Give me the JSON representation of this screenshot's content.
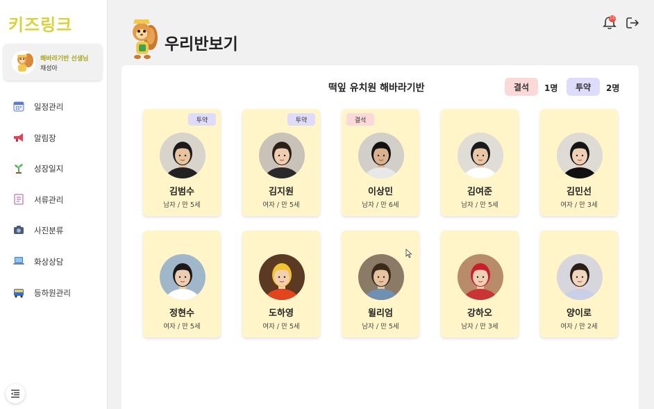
{
  "app": {
    "logo": "키즈링크"
  },
  "profile": {
    "role": "해바라기반 선생님",
    "name": "채성아"
  },
  "menu": [
    {
      "label": "일정관리",
      "icon": "calendar-icon"
    },
    {
      "label": "알림장",
      "icon": "megaphone-icon"
    },
    {
      "label": "성장일지",
      "icon": "sprout-icon"
    },
    {
      "label": "서류관리",
      "icon": "document-icon"
    },
    {
      "label": "사진분류",
      "icon": "camera-icon"
    },
    {
      "label": "화상상담",
      "icon": "laptop-icon"
    },
    {
      "label": "등하원관리",
      "icon": "bus-icon"
    }
  ],
  "header": {
    "title": "우리반보기",
    "notification_count": "15"
  },
  "class_info": {
    "title": "떡잎 유치원 해바라기반",
    "absent_label": "결석",
    "absent_count": "1명",
    "medication_label": "투약",
    "medication_count": "2명"
  },
  "children": [
    {
      "name": "김범수",
      "info": "남자 / 만 5세",
      "tag": "투약"
    },
    {
      "name": "김지원",
      "info": "여자 / 만 5세",
      "tag": "투약"
    },
    {
      "name": "이상민",
      "info": "남자 / 만 6세",
      "tag": "결석"
    },
    {
      "name": "김여준",
      "info": "남자 / 만 5세",
      "tag": ""
    },
    {
      "name": "김민선",
      "info": "여자 / 만 3세",
      "tag": ""
    },
    {
      "name": "정현수",
      "info": "여자 / 만 5세",
      "tag": ""
    },
    {
      "name": "도하영",
      "info": "여자 / 만 5세",
      "tag": ""
    },
    {
      "name": "윌리엄",
      "info": "남자 / 만 5세",
      "tag": ""
    },
    {
      "name": "강하오",
      "info": "남자 / 만 3세",
      "tag": ""
    },
    {
      "name": "양이로",
      "info": "여자 / 만 2세",
      "tag": ""
    }
  ],
  "colors": {
    "logo": "#d9d23c",
    "card_bg": "#fff5c9",
    "absent": "#fbd9d9",
    "medication": "#dfdcfb"
  }
}
